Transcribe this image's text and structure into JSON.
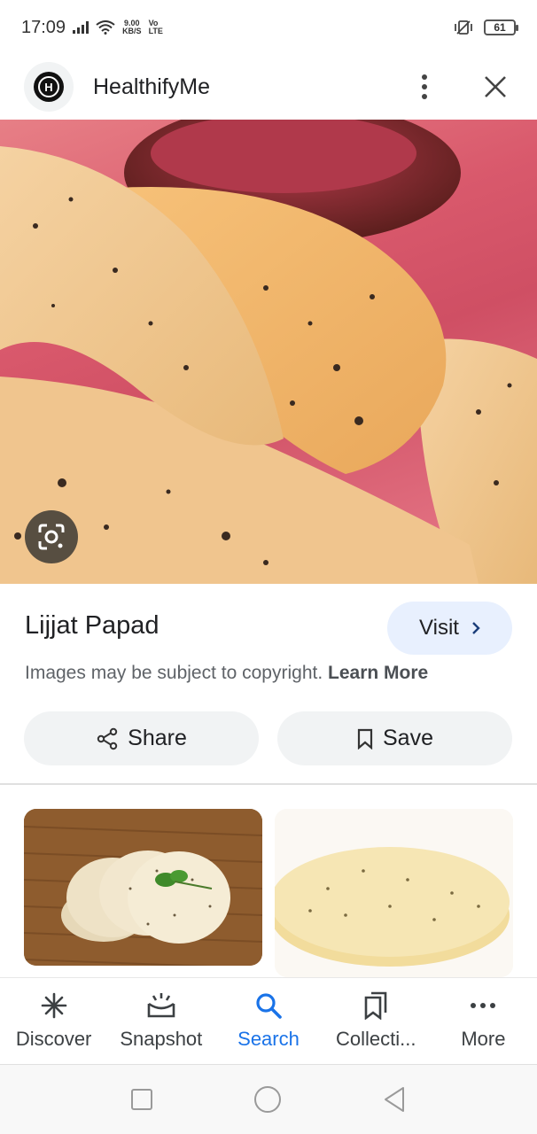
{
  "status_bar": {
    "time": "17:09",
    "net_speed_value": "9.00",
    "net_speed_unit": "KB/S",
    "volte_top": "Vo",
    "volte_bottom": "LTE",
    "battery": "61"
  },
  "header": {
    "site_name": "HealthifyMe",
    "logo_letter": "H"
  },
  "info": {
    "title": "Lijjat Papad",
    "visit_label": "Visit",
    "copyright_text": "Images may be subject to copyright.",
    "learn_more": "Learn More"
  },
  "actions": {
    "share_label": "Share",
    "save_label": "Save"
  },
  "bottom_nav": {
    "items": [
      {
        "label": "Discover",
        "icon": "asterisk-icon"
      },
      {
        "label": "Snapshot",
        "icon": "snapshot-icon"
      },
      {
        "label": "Search",
        "icon": "search-icon"
      },
      {
        "label": "Collecti...",
        "icon": "collections-icon"
      },
      {
        "label": "More",
        "icon": "more-dots-icon"
      }
    ],
    "active_label": "Search"
  },
  "colors": {
    "accent": "#1a73e8",
    "visit_bg": "#e8f0fe",
    "chip_bg": "#f1f3f4"
  }
}
